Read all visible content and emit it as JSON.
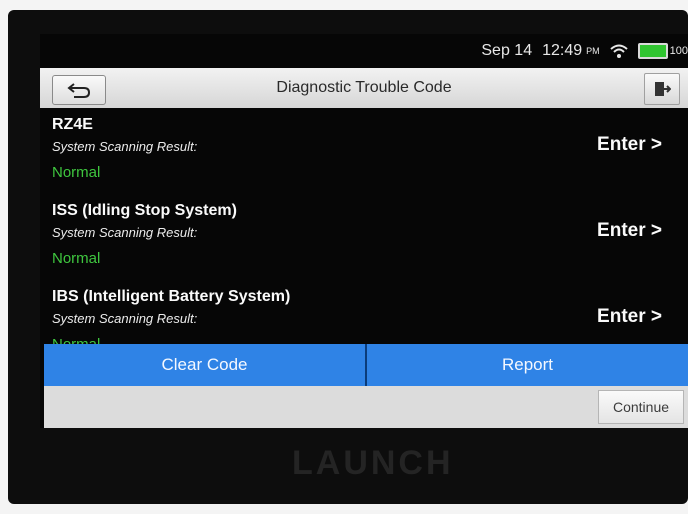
{
  "status_bar": {
    "date": "Sep 14",
    "time": "12:49",
    "ampm": "PM",
    "battery_text": "100"
  },
  "header": {
    "title": "Diagnostic Trouble Code",
    "back_icon": "back-arrow-icon",
    "exit_icon": "exit-icon"
  },
  "systems": [
    {
      "name": "RZ4E",
      "result_label": "System Scanning Result:",
      "result": "Normal",
      "action": "Enter >"
    },
    {
      "name": "ISS (Idling Stop System)",
      "result_label": "System Scanning Result:",
      "result": "Normal",
      "action": "Enter >"
    },
    {
      "name": "IBS (Intelligent Battery System)",
      "result_label": "System Scanning Result:",
      "result": "Normal",
      "action": "Enter >"
    }
  ],
  "actions": {
    "clear_code": "Clear Code",
    "report": "Report"
  },
  "footer": {
    "continue": "Continue"
  },
  "brand": "LAUNCH",
  "colors": {
    "accent": "#2f83e6",
    "status_ok": "#3fc63f",
    "battery": "#31c531"
  }
}
